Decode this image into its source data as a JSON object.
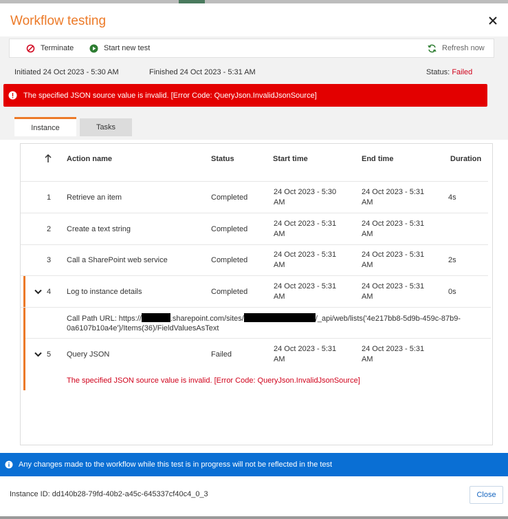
{
  "dialog": {
    "title": "Workflow testing"
  },
  "toolbar": {
    "terminate_label": "Terminate",
    "start_new_label": "Start new test",
    "refresh_label": "Refresh now"
  },
  "meta": {
    "initiated_label": "Initiated",
    "initiated_value": "24 Oct 2023 - 5:30 AM",
    "finished_label": "Finished",
    "finished_value": "24 Oct 2023 - 5:31 AM",
    "status_label": "Status:",
    "status_value": "Failed"
  },
  "error_banner": {
    "text": "The specified JSON source value is invalid. [Error Code: QueryJson.InvalidJsonSource]"
  },
  "tabs": [
    {
      "label": "Instance",
      "active": true
    },
    {
      "label": "Tasks",
      "active": false
    }
  ],
  "table": {
    "headers": {
      "action_name": "Action name",
      "status": "Status",
      "start_time": "Start time",
      "end_time": "End time",
      "duration": "Duration"
    },
    "rows": [
      {
        "num": "1",
        "name": "Retrieve an item",
        "status": "Completed",
        "start": "24 Oct 2023 - 5:30 AM",
        "end": "24 Oct 2023 - 5:31 AM",
        "duration": "4s"
      },
      {
        "num": "2",
        "name": "Create a text string",
        "status": "Completed",
        "start": "24 Oct 2023 - 5:31 AM",
        "end": "24 Oct 2023 - 5:31 AM",
        "duration": ""
      },
      {
        "num": "3",
        "name": "Call a SharePoint web service",
        "status": "Completed",
        "start": "24 Oct 2023 - 5:31 AM",
        "end": "24 Oct 2023 - 5:31 AM",
        "duration": "2s"
      },
      {
        "num": "4",
        "name": "Log to instance details",
        "status": "Completed",
        "start": "24 Oct 2023 - 5:31 AM",
        "end": "24 Oct 2023 - 5:31 AM",
        "duration": "0s"
      },
      {
        "num": "5",
        "name": "Query JSON",
        "status": "Failed",
        "start": "24 Oct 2023 - 5:31 AM",
        "end": "24 Oct 2023 - 5:31 AM",
        "duration": ""
      }
    ],
    "row4_detail": {
      "prefix": "Call Path URL: https://",
      "middle": ".sharepoint.com/sites/",
      "suffix": "/_api/web/lists('4e217bb8-5d9b-459c-87b9-0a6107b10a4e')/Items(36)/FieldValuesAsText"
    },
    "row5_detail": "The specified JSON source value is invalid. [Error Code: QueryJson.InvalidJsonSource]"
  },
  "info_banner": {
    "text": "Any changes made to the workflow while this test is in progress will not be reflected in the test"
  },
  "footer": {
    "instance_id_label": "Instance ID:",
    "instance_id_value": "dd140b28-79fd-40b2-a45c-645337cf40c4_0_3",
    "close_label": "Close"
  },
  "colors": {
    "accent_orange": "#ec7a28",
    "error_red": "#e30000",
    "failed_text": "#d0021b",
    "completed_text": "#2e7d32",
    "info_blue": "#0a6fd4"
  }
}
